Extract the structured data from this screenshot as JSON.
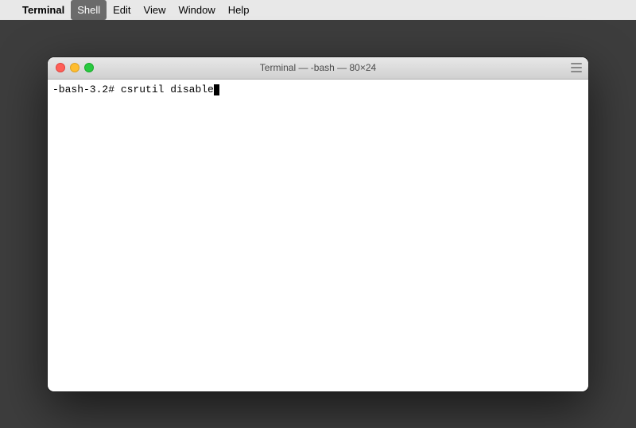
{
  "menu_bar": {
    "apple_symbol": "",
    "items": [
      {
        "label": "Terminal",
        "bold": true,
        "active": false
      },
      {
        "label": "Shell",
        "bold": false,
        "active": true
      },
      {
        "label": "Edit",
        "bold": false,
        "active": false
      },
      {
        "label": "View",
        "bold": false,
        "active": false
      },
      {
        "label": "Window",
        "bold": false,
        "active": false
      },
      {
        "label": "Help",
        "bold": false,
        "active": false
      }
    ]
  },
  "window": {
    "title": "Terminal — -bash — 80×24",
    "terminal_line": {
      "prompt": "-bash-3.2# ",
      "command": "csrutil disable"
    }
  }
}
